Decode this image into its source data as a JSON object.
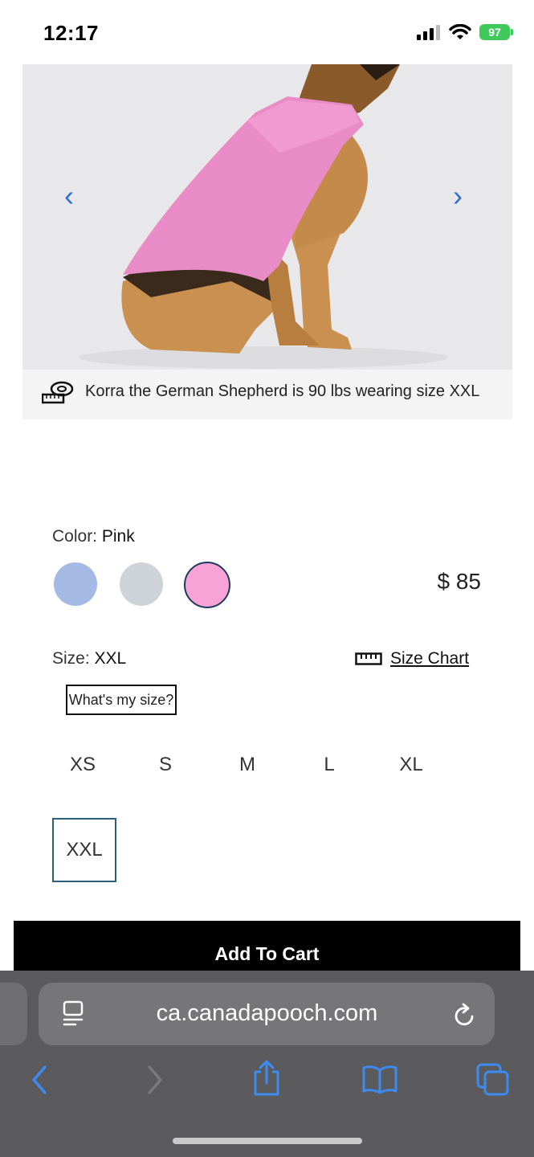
{
  "status_bar": {
    "time": "12:17",
    "battery": "97"
  },
  "product": {
    "caption": "Korra the German Shepherd is 90 lbs wearing size XXL",
    "color_label": "Color:",
    "color_value": "Pink",
    "colors": [
      "#a4b9e4",
      "#cdd3d8",
      "#f7a3d5"
    ],
    "price": "$ 85",
    "size_label": "Size:",
    "size_value": "XXL",
    "size_chart": "Size Chart",
    "whats_my_size": "What's my size?",
    "sizes": [
      "XS",
      "S",
      "M",
      "L",
      "XL",
      "XXL"
    ],
    "add_to_cart": "Add To Cart"
  },
  "browser": {
    "url": "ca.canadapooch.com"
  }
}
